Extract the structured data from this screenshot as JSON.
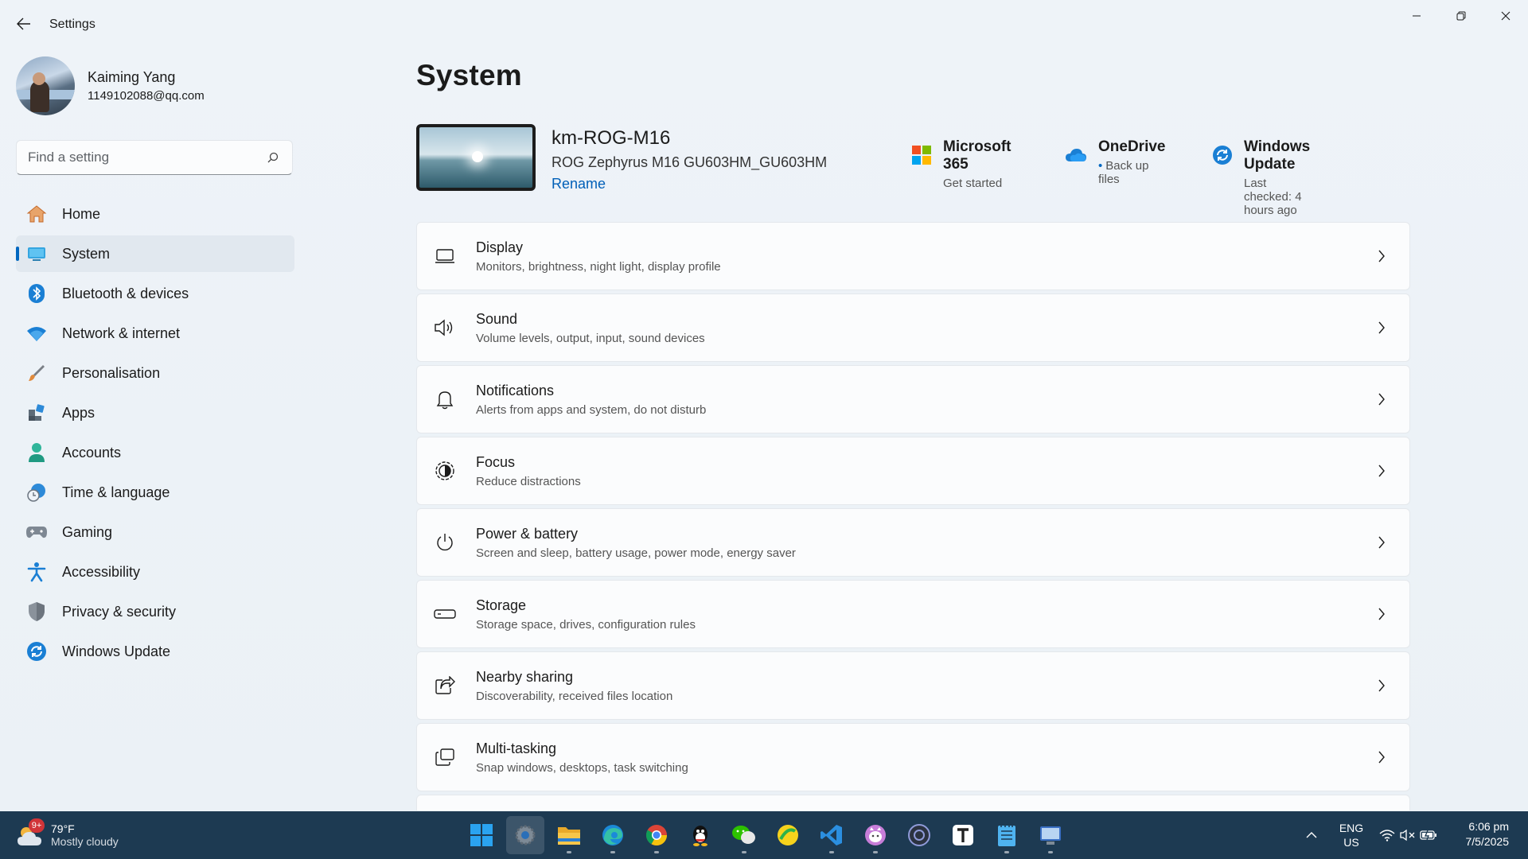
{
  "window": {
    "title": "Settings"
  },
  "profile": {
    "name": "Kaiming Yang",
    "email": "1149102088@qq.com"
  },
  "search": {
    "placeholder": "Find a setting"
  },
  "sidebar": {
    "items": [
      {
        "label": "Home",
        "icon": "home-icon"
      },
      {
        "label": "System",
        "icon": "system-icon",
        "active": true
      },
      {
        "label": "Bluetooth & devices",
        "icon": "bluetooth-icon"
      },
      {
        "label": "Network & internet",
        "icon": "wifi-icon"
      },
      {
        "label": "Personalisation",
        "icon": "brush-icon"
      },
      {
        "label": "Apps",
        "icon": "apps-icon"
      },
      {
        "label": "Accounts",
        "icon": "accounts-icon"
      },
      {
        "label": "Time & language",
        "icon": "clock-globe-icon"
      },
      {
        "label": "Gaming",
        "icon": "gamepad-icon"
      },
      {
        "label": "Accessibility",
        "icon": "accessibility-icon"
      },
      {
        "label": "Privacy & security",
        "icon": "shield-icon"
      },
      {
        "label": "Windows Update",
        "icon": "windows-update-icon"
      }
    ]
  },
  "main": {
    "title": "System",
    "device": {
      "name": "km-ROG-M16",
      "model": "ROG Zephyrus M16 GU603HM_GU603HM",
      "rename_label": "Rename"
    },
    "quick_links": [
      {
        "title": "Microsoft 365",
        "subtitle": "Get started",
        "icon": "microsoft-365-icon"
      },
      {
        "title": "OneDrive",
        "subtitle": "Back up files",
        "icon": "onedrive-icon"
      },
      {
        "title": "Windows Update",
        "subtitle": "Last checked: 4 hours ago",
        "icon": "windows-update-icon"
      }
    ],
    "settings": [
      {
        "title": "Display",
        "subtitle": "Monitors, brightness, night light, display profile",
        "icon": "display-icon"
      },
      {
        "title": "Sound",
        "subtitle": "Volume levels, output, input, sound devices",
        "icon": "speaker-icon"
      },
      {
        "title": "Notifications",
        "subtitle": "Alerts from apps and system, do not disturb",
        "icon": "bell-icon"
      },
      {
        "title": "Focus",
        "subtitle": "Reduce distractions",
        "icon": "focus-icon"
      },
      {
        "title": "Power & battery",
        "subtitle": "Screen and sleep, battery usage, power mode, energy saver",
        "icon": "power-icon"
      },
      {
        "title": "Storage",
        "subtitle": "Storage space, drives, configuration rules",
        "icon": "storage-icon"
      },
      {
        "title": "Nearby sharing",
        "subtitle": "Discoverability, received files location",
        "icon": "share-icon"
      },
      {
        "title": "Multi-tasking",
        "subtitle": "Snap windows, desktops, task switching",
        "icon": "multitasking-icon"
      }
    ]
  },
  "taskbar": {
    "weather": {
      "badge": "9+",
      "temp": "79°F",
      "desc": "Mostly cloudy"
    },
    "apps": [
      "windows-start-icon",
      "settings-icon",
      "file-explorer-icon",
      "edge-icon",
      "chrome-icon",
      "qq-icon",
      "wechat-icon",
      "app-yellow-icon",
      "vscode-icon",
      "app-cat-icon",
      "app-circle-icon",
      "typora-icon",
      "notepad-icon",
      "remote-desktop-icon"
    ],
    "lang": {
      "line1": "ENG",
      "line2": "US"
    },
    "clock": {
      "time": "6:06 pm",
      "date": "7/5/2025"
    }
  },
  "colors": {
    "accent": "#0067c0",
    "window_bg": "#eef3f8",
    "taskbar_bg": "#1d3a52"
  }
}
